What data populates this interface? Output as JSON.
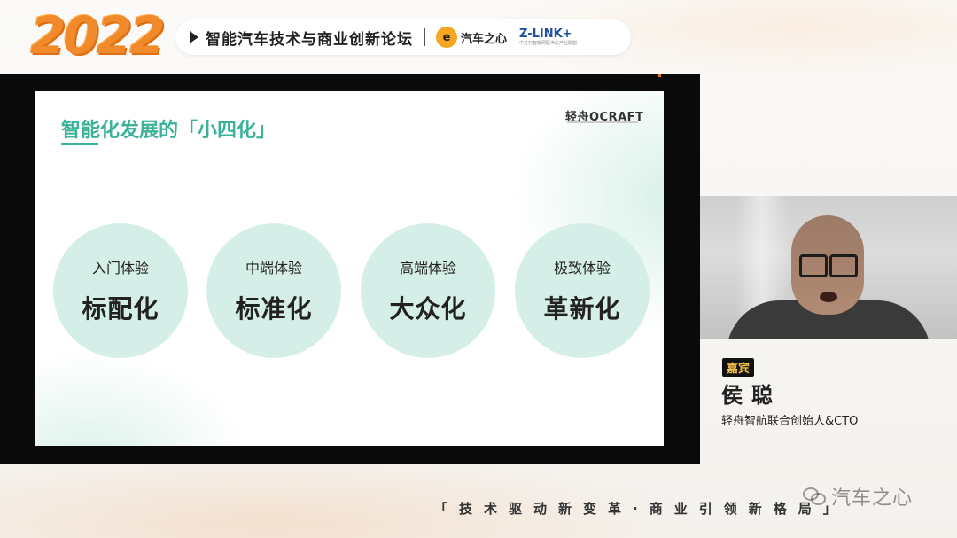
{
  "header": {
    "year": "2022",
    "forum_title": "智能汽车技术与商业创新论坛",
    "logo_autohome_symbol": "e",
    "logo_autohome_text": "汽车之心",
    "logo_zlink_text": "Z-LINK+",
    "logo_zlink_sub": "中关村智能网联汽车产业联盟"
  },
  "slide": {
    "title": "智能化发展的「小四化」",
    "brand": "轻舟QCRAFT",
    "circles": [
      {
        "small": "入门体验",
        "big": "标配化"
      },
      {
        "small": "中端体验",
        "big": "标准化"
      },
      {
        "small": "高端体验",
        "big": "大众化"
      },
      {
        "small": "极致体验",
        "big": "革新化"
      }
    ]
  },
  "speaker": {
    "tag": "嘉宾",
    "name": "侯聪",
    "role": "轻舟智航联合创始人&CTO"
  },
  "footer": {
    "slogan": "「技术驱动新变革·商业引领新格局」",
    "watermark": "汽车之心"
  },
  "colors": {
    "accent_orange": "#f08a2a",
    "slide_green": "#3db29a",
    "circle_fill": "#d5efe8"
  },
  "icons": [
    "play-icon",
    "wechat-icon"
  ]
}
